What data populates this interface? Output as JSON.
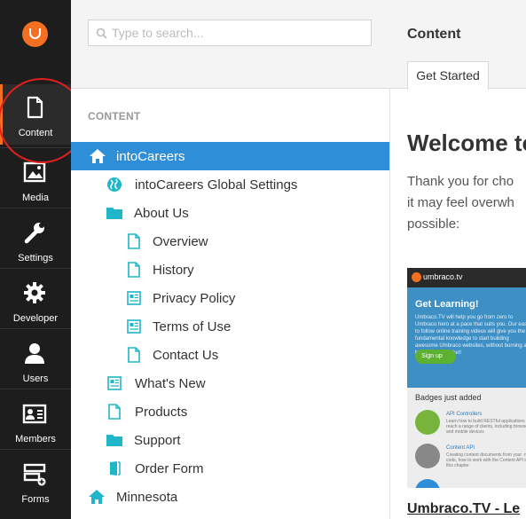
{
  "sidebar": {
    "items": [
      {
        "label": "Content",
        "icon": "document-icon"
      },
      {
        "label": "Media",
        "icon": "image-icon"
      },
      {
        "label": "Settings",
        "icon": "wrench-icon"
      },
      {
        "label": "Developer",
        "icon": "gear-icon"
      },
      {
        "label": "Users",
        "icon": "user-icon"
      },
      {
        "label": "Members",
        "icon": "id-card-icon"
      },
      {
        "label": "Forms",
        "icon": "form-icon"
      }
    ]
  },
  "search": {
    "placeholder": "Type to search..."
  },
  "tree": {
    "section_title": "CONTENT",
    "nodes": [
      {
        "label": "intoCareers",
        "icon": "home-icon",
        "depth": 0,
        "selected": true
      },
      {
        "label": "intoCareers Global Settings",
        "icon": "globe-icon",
        "depth": 1
      },
      {
        "label": "About Us",
        "icon": "folder-icon",
        "depth": 1
      },
      {
        "label": "Overview",
        "icon": "page-icon",
        "depth": 2
      },
      {
        "label": "History",
        "icon": "page-icon",
        "depth": 2
      },
      {
        "label": "Privacy Policy",
        "icon": "article-icon",
        "depth": 2
      },
      {
        "label": "Terms of Use",
        "icon": "article-icon",
        "depth": 2
      },
      {
        "label": "Contact Us",
        "icon": "page-icon",
        "depth": 2
      },
      {
        "label": "What's New",
        "icon": "article-icon",
        "depth": 1
      },
      {
        "label": "Products",
        "icon": "page-icon",
        "depth": 1
      },
      {
        "label": "Support",
        "icon": "folder-icon",
        "depth": 1
      },
      {
        "label": "Order Form",
        "icon": "door-icon",
        "depth": 1
      },
      {
        "label": "Minnesota",
        "icon": "home-icon",
        "depth": 0
      }
    ]
  },
  "content": {
    "title": "Content",
    "tab": "Get Started",
    "welcome": "Welcome to",
    "intro_lines": [
      "Thank you for cho",
      "it may feel overwh",
      "possible:"
    ],
    "video_title": "Umbraco.TV - Le"
  },
  "thumbnail": {
    "brand": "umbraco.tv",
    "hero_title": "Get Learning!",
    "hero_text": "Umbraco.TV will help you go from zero to Umbraco hero at a pace that suits you. Our easy to follow online training videos will give you the fundamental knowledge to start building awesome Umbraco websites, without burning a hole in your pocket!",
    "signup": "Sign up",
    "badges_title": "Badges just added",
    "items": [
      {
        "title": "API Controllers",
        "desc": "Learn how to build RESTful applications that reach a range of clients, including browsers and mobile devices"
      },
      {
        "title": "Content API",
        "desc": "Creating content documents from your .net code, how to work with the Content API in this chapter"
      }
    ]
  },
  "colors": {
    "accent": "#f36f21",
    "selected": "#2f8ed8",
    "tree_icon": "#1fb6c9",
    "sidebar_bg": "#1d1d1d"
  }
}
